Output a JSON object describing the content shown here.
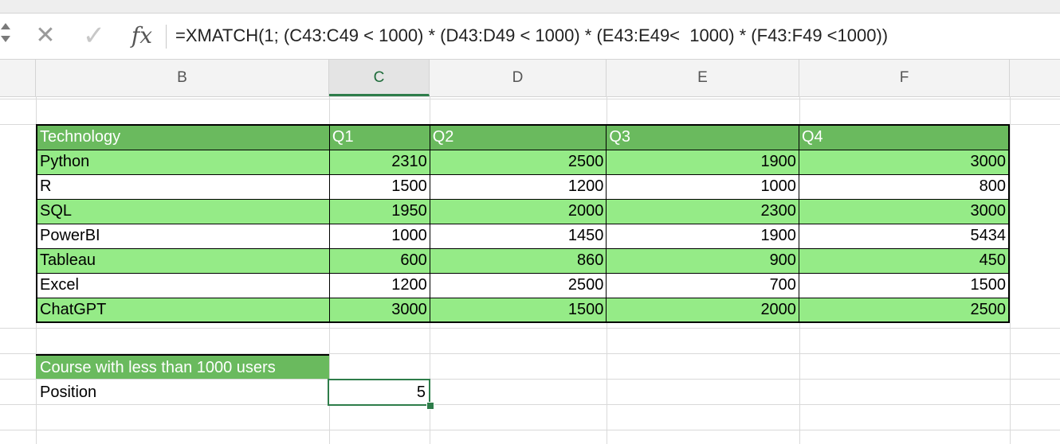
{
  "formula_bar": {
    "formula": "=XMATCH(1; (C43:C49 < 1000) * (D43:D49 < 1000) * (E43:E49<  1000) * (F43:F49 <1000))",
    "cancel_icon": "close-icon",
    "enter_icon": "checkmark-icon",
    "fx_label": "fx"
  },
  "columns": [
    "B",
    "C",
    "D",
    "E",
    "F"
  ],
  "selected_column": "C",
  "table": {
    "headers": [
      "Technology",
      "Q1",
      "Q2",
      "Q3",
      "Q4"
    ],
    "rows": [
      {
        "name": "Python",
        "q1": "2310",
        "q2": "2500",
        "q3": "1900",
        "q4": "3000"
      },
      {
        "name": "R",
        "q1": "1500",
        "q2": "1200",
        "q3": "1000",
        "q4": "800"
      },
      {
        "name": "SQL",
        "q1": "1950",
        "q2": "2000",
        "q3": "2300",
        "q4": "3000"
      },
      {
        "name": "PowerBI",
        "q1": "1000",
        "q2": "1450",
        "q3": "1900",
        "q4": "5434"
      },
      {
        "name": "Tableau",
        "q1": "600",
        "q2": "860",
        "q3": "900",
        "q4": "450"
      },
      {
        "name": "Excel",
        "q1": "1200",
        "q2": "2500",
        "q3": "700",
        "q4": "1500"
      },
      {
        "name": "ChatGPT",
        "q1": "3000",
        "q2": "1500",
        "q3": "2000",
        "q4": "2500"
      }
    ]
  },
  "summary": {
    "header": "Course with less than 1000 users",
    "label": "Position",
    "value": "5"
  },
  "colors": {
    "header_green": "#6aba5e",
    "row_green": "#95eb87",
    "selection_green": "#2e7d4a"
  }
}
